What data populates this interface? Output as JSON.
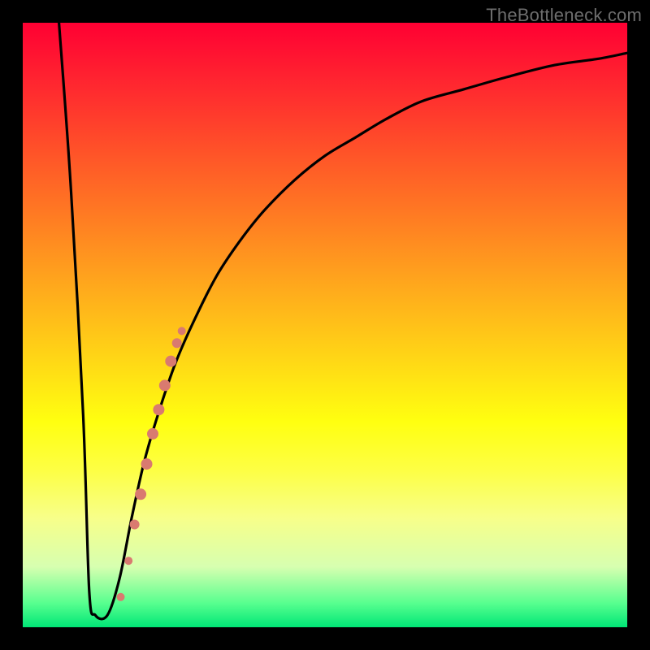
{
  "watermark": "TheBottleneck.com",
  "chart_data": {
    "type": "line",
    "title": "",
    "xlabel": "",
    "ylabel": "",
    "xlim": [
      0,
      100
    ],
    "ylim": [
      0,
      100
    ],
    "series": [
      {
        "name": "bottleneck-curve",
        "x": [
          6,
          8,
          10,
          11,
          12,
          14,
          16,
          18,
          20,
          22,
          25,
          28,
          32,
          36,
          40,
          45,
          50,
          55,
          60,
          66,
          73,
          80,
          88,
          95,
          100
        ],
        "y": [
          100,
          72,
          35,
          6,
          2,
          2,
          8,
          18,
          27,
          34,
          43,
          50,
          58,
          64,
          69,
          74,
          78,
          81,
          84,
          87,
          89,
          91,
          93,
          94,
          95
        ]
      }
    ],
    "highlight_points": {
      "name": "data-dots",
      "color": "#d97a70",
      "points": [
        {
          "x": 16.2,
          "y": 5,
          "r": 5
        },
        {
          "x": 17.5,
          "y": 11,
          "r": 5
        },
        {
          "x": 18.5,
          "y": 17,
          "r": 6
        },
        {
          "x": 19.5,
          "y": 22,
          "r": 7
        },
        {
          "x": 20.5,
          "y": 27,
          "r": 7
        },
        {
          "x": 21.5,
          "y": 32,
          "r": 7
        },
        {
          "x": 22.5,
          "y": 36,
          "r": 7
        },
        {
          "x": 23.5,
          "y": 40,
          "r": 7
        },
        {
          "x": 24.5,
          "y": 44,
          "r": 7
        },
        {
          "x": 25.5,
          "y": 47,
          "r": 6
        },
        {
          "x": 26.3,
          "y": 49,
          "r": 5
        }
      ]
    }
  }
}
